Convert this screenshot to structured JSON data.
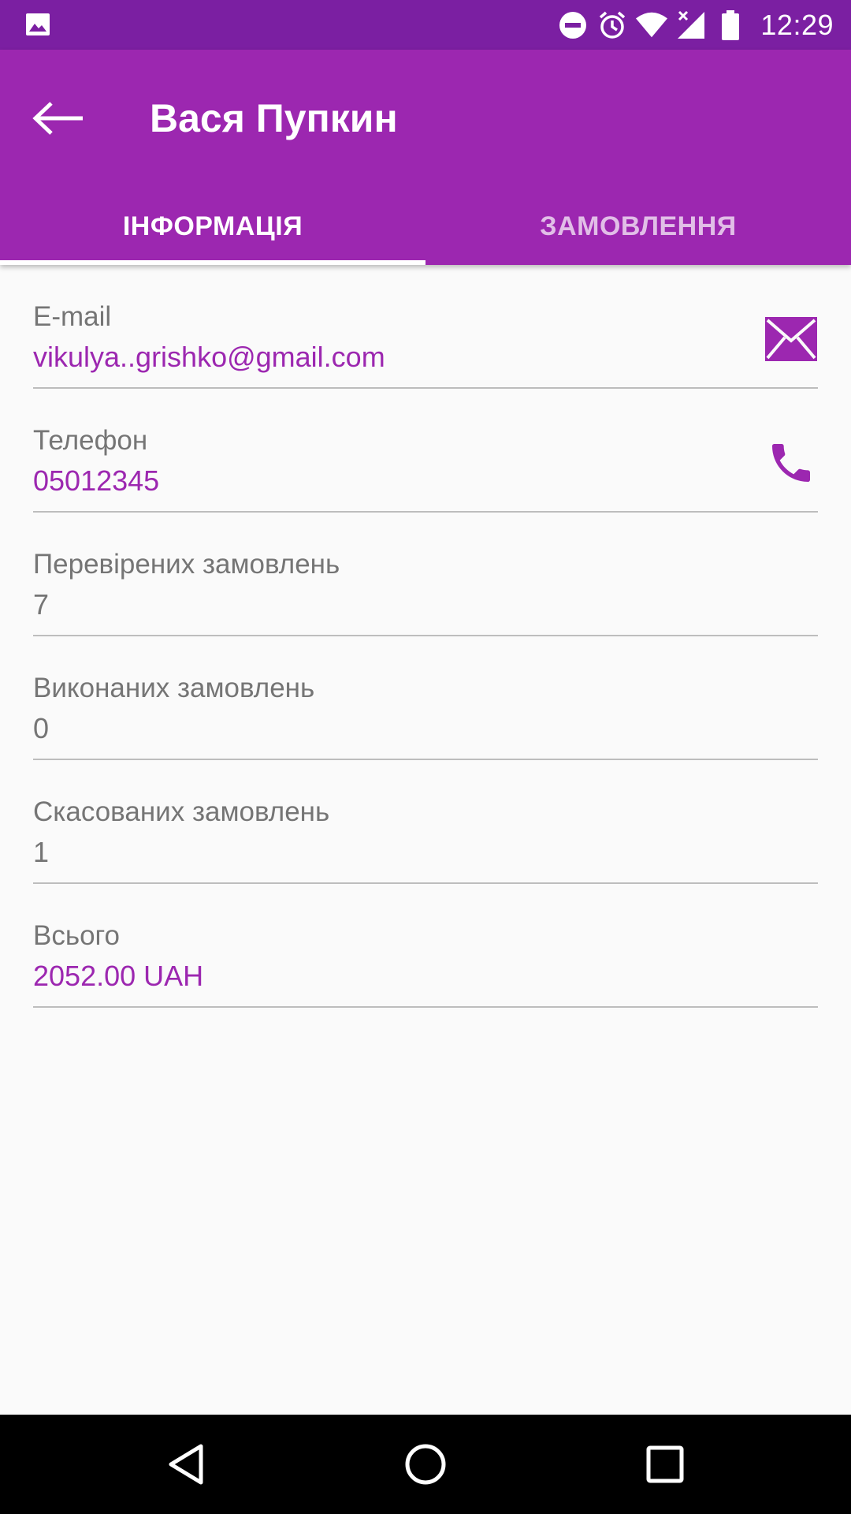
{
  "status_bar": {
    "time": "12:29",
    "icons": [
      "image-icon",
      "dnd-icon",
      "alarm-icon",
      "wifi-icon",
      "signal-icon",
      "battery-icon"
    ]
  },
  "app_bar": {
    "title": "Вася Пупкин",
    "back_icon": "arrow-back-icon",
    "tabs": [
      {
        "label": "ІНФОРМАЦІЯ",
        "active": true
      },
      {
        "label": "ЗАМОВЛЕННЯ",
        "active": false
      }
    ]
  },
  "info": {
    "email": {
      "label": "E-mail",
      "value": "vikulya..grishko@gmail.com",
      "action_icon": "mail-icon"
    },
    "phone": {
      "label": "Телефон",
      "value": "05012345",
      "action_icon": "phone-icon"
    },
    "checked": {
      "label": "Перевірених замовлень",
      "value": "7"
    },
    "completed": {
      "label": "Виконаних замовлень",
      "value": "0"
    },
    "cancelled": {
      "label": "Скасованих замовлень",
      "value": "1"
    },
    "total": {
      "label": "Всього",
      "value": "2052.00 UAH"
    }
  },
  "colors": {
    "status_bar": "#7b1fa2",
    "primary": "#9c27b0",
    "text_secondary": "#757575",
    "divider": "#bdbdbd",
    "background": "#fafafa"
  },
  "nav_bar": {
    "icons": [
      "nav-back-icon",
      "nav-home-icon",
      "nav-recents-icon"
    ]
  }
}
